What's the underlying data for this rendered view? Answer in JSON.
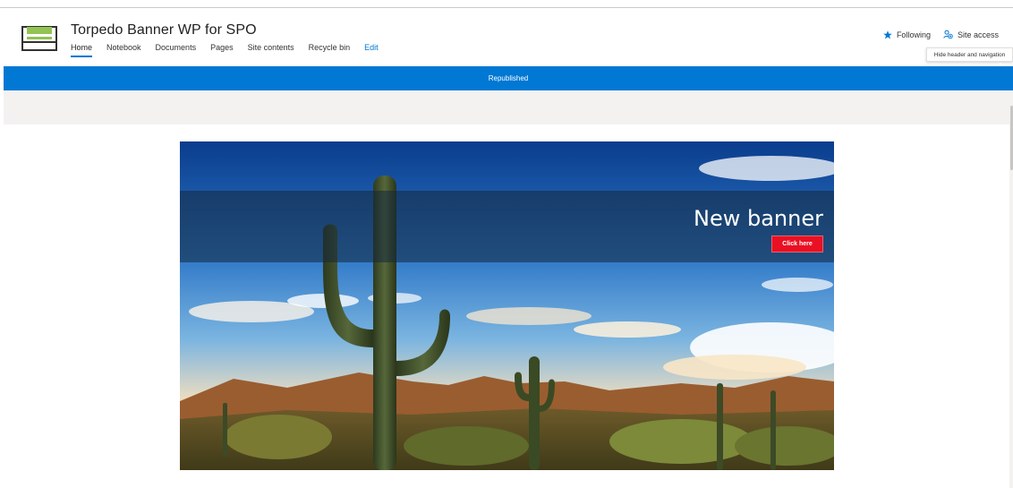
{
  "site": {
    "title": "Torpedo Banner WP for SPO"
  },
  "nav": {
    "items": [
      {
        "label": "Home",
        "active": true
      },
      {
        "label": "Notebook"
      },
      {
        "label": "Documents"
      },
      {
        "label": "Pages"
      },
      {
        "label": "Site contents"
      },
      {
        "label": "Recycle bin"
      },
      {
        "label": "Edit",
        "accent": true
      }
    ]
  },
  "header_actions": {
    "following_label": "Following",
    "following_icon": "star-icon",
    "site_access_label": "Site access",
    "site_access_icon": "people-icon"
  },
  "tooltip": {
    "text": "Hide header and navigation"
  },
  "status": {
    "text": "Republished",
    "color": "#0078d4"
  },
  "banner": {
    "title": "New banner",
    "button_label": "Click here",
    "button_color": "#e81123",
    "image": "saguaro-cactus-desert-landscape"
  },
  "colors": {
    "accent": "#0078d4",
    "logo_green": "#92c353"
  }
}
